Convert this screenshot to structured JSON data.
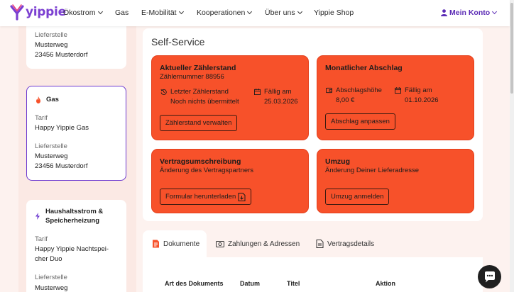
{
  "header": {
    "logo_text": "yippie",
    "nav": [
      "Ökostrom",
      "Gas",
      "E-Mobilität",
      "Kooperationen",
      "Über uns",
      "Yippie Shop"
    ],
    "account_label": "Mein Konto"
  },
  "contracts": {
    "card1": {
      "lieferstelle_label": "Lieferstelle",
      "street": "Musterweg",
      "city": "23456 Musterdorf"
    },
    "card2": {
      "title": "Gas",
      "tarif_label": "Tarif",
      "tarif": "Happy Yippie Gas",
      "lieferstelle_label": "Lieferstelle",
      "street": "Musterweg",
      "city": "23456 Musterdorf"
    },
    "card3": {
      "title_line1": "Haushaltsstrom &",
      "title_line2": "Speicherheizung",
      "tarif_label": "Tarif",
      "tarif_line1": "Happy Yippie Nachtspei-",
      "tarif_line2": "cher Duo",
      "lieferstelle_label": "Lieferstelle",
      "street": "Musterweg"
    }
  },
  "self_service": {
    "title": "Self-Service",
    "meter": {
      "title": "Aktueller Zählerstand",
      "subtitle": "Zählernummer 88956",
      "last_label": "Letzter Zählerstand",
      "last_value": "Noch nichts übermittelt",
      "due_label": "Fällig am",
      "due_date": "25.03.2026",
      "button": "Zählerstand verwalten"
    },
    "abschlag": {
      "title": "Monatlicher Abschlag",
      "amount_label": "Abschlagshöhe",
      "amount": "8,00 €",
      "due_label": "Fällig am",
      "due_date": "01.10.2026",
      "button": "Abschlag anpassen"
    },
    "umschreibung": {
      "title": "Vertragsumschreibung",
      "subtitle": "Änderung des Vertragspartners",
      "button": "Formular herunterladen"
    },
    "umzug": {
      "title": "Umzug",
      "subtitle": "Änderung Deiner Lieferadresse",
      "button": "Umzug anmelden"
    }
  },
  "tabs": [
    "Dokumente",
    "Zahlungen & Adressen",
    "Vertragsdetails"
  ],
  "table_headers": [
    "Art des Dokuments",
    "Datum",
    "Titel",
    "Aktion"
  ],
  "colors": {
    "brand_purple": "#6d3ad0",
    "accent_orange": "#f7512a",
    "background": "#fdf2ef"
  }
}
